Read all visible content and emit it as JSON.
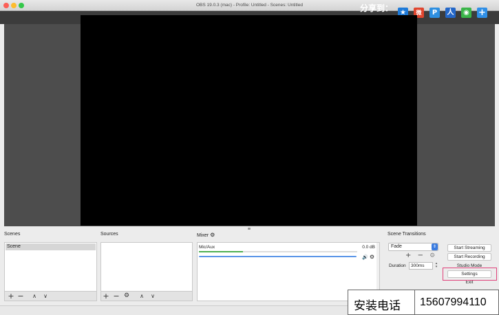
{
  "window": {
    "title": "OBS 19.0.3 (mac) - Profile: Untitled - Scenes: Untitled",
    "traffic_lights": {
      "close": "#fc5f57",
      "minimize": "#fdbc2e",
      "zoom": "#34c84a"
    }
  },
  "share": {
    "label": "分享到：",
    "icons": [
      {
        "name": "qzone-icon",
        "glyph": "★",
        "color": "#1e7ad8"
      },
      {
        "name": "weibo-icon",
        "glyph": "微",
        "color": "#e0462f"
      },
      {
        "name": "p-icon",
        "glyph": "P",
        "color": "#2e8fe0"
      },
      {
        "name": "renren-icon",
        "glyph": "人",
        "color": "#2467c8"
      },
      {
        "name": "wechat-icon",
        "glyph": "◉",
        "color": "#3bb549"
      },
      {
        "name": "more-icon",
        "glyph": "+",
        "color": "#2f8fe6"
      }
    ]
  },
  "docks": {
    "scenes": {
      "label": "Scenes",
      "items": [
        "Scene"
      ]
    },
    "sources": {
      "label": "Sources"
    },
    "mixer": {
      "label": "Mixer",
      "channel": "Mic/Aux",
      "db": "0.0 dB",
      "meter_level": 0.28,
      "volume_level": 1.0
    },
    "transitions": {
      "label": "Scene Transitions",
      "selected": "Fade",
      "duration_label": "Duration",
      "duration_value": "300ms"
    },
    "controls": {
      "buttons": [
        "Start Streaming",
        "Start Recording",
        "Studio Mode",
        "Settings",
        "Exit"
      ]
    }
  },
  "toolbar_glyphs": {
    "add": "+",
    "remove": "−",
    "up": "∧",
    "down": "∨",
    "gear": "⚙"
  },
  "phone": {
    "label": "安装电话",
    "number": "15607994110"
  }
}
